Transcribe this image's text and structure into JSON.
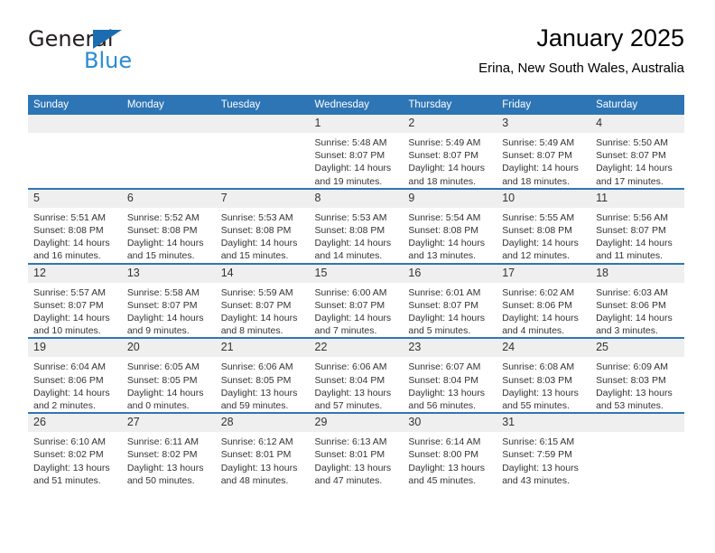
{
  "brand": {
    "name_part1": "General",
    "name_part2": "Blue",
    "triangle_color": "#1b6cb0",
    "blue_color": "#2a8bd4"
  },
  "header": {
    "title": "January 2025",
    "subtitle": "Erina, New South Wales, Australia"
  },
  "theme": {
    "header_bg": "#2e75b6",
    "daynum_bg": "#efefef",
    "separator": "#2e75b6"
  },
  "weekdays": [
    "Sunday",
    "Monday",
    "Tuesday",
    "Wednesday",
    "Thursday",
    "Friday",
    "Saturday"
  ],
  "labels": {
    "sunrise": "Sunrise:",
    "sunset": "Sunset:",
    "daylight": "Daylight:"
  },
  "weeks": [
    [
      {
        "day": "",
        "blank": true
      },
      {
        "day": "",
        "blank": true
      },
      {
        "day": "",
        "blank": true
      },
      {
        "day": "1",
        "sunrise": "Sunrise: 5:48 AM",
        "sunset": "Sunset: 8:07 PM",
        "daylight1": "Daylight: 14 hours",
        "daylight2": "and 19 minutes."
      },
      {
        "day": "2",
        "sunrise": "Sunrise: 5:49 AM",
        "sunset": "Sunset: 8:07 PM",
        "daylight1": "Daylight: 14 hours",
        "daylight2": "and 18 minutes."
      },
      {
        "day": "3",
        "sunrise": "Sunrise: 5:49 AM",
        "sunset": "Sunset: 8:07 PM",
        "daylight1": "Daylight: 14 hours",
        "daylight2": "and 18 minutes."
      },
      {
        "day": "4",
        "sunrise": "Sunrise: 5:50 AM",
        "sunset": "Sunset: 8:07 PM",
        "daylight1": "Daylight: 14 hours",
        "daylight2": "and 17 minutes."
      }
    ],
    [
      {
        "day": "5",
        "sunrise": "Sunrise: 5:51 AM",
        "sunset": "Sunset: 8:08 PM",
        "daylight1": "Daylight: 14 hours",
        "daylight2": "and 16 minutes."
      },
      {
        "day": "6",
        "sunrise": "Sunrise: 5:52 AM",
        "sunset": "Sunset: 8:08 PM",
        "daylight1": "Daylight: 14 hours",
        "daylight2": "and 15 minutes."
      },
      {
        "day": "7",
        "sunrise": "Sunrise: 5:53 AM",
        "sunset": "Sunset: 8:08 PM",
        "daylight1": "Daylight: 14 hours",
        "daylight2": "and 15 minutes."
      },
      {
        "day": "8",
        "sunrise": "Sunrise: 5:53 AM",
        "sunset": "Sunset: 8:08 PM",
        "daylight1": "Daylight: 14 hours",
        "daylight2": "and 14 minutes."
      },
      {
        "day": "9",
        "sunrise": "Sunrise: 5:54 AM",
        "sunset": "Sunset: 8:08 PM",
        "daylight1": "Daylight: 14 hours",
        "daylight2": "and 13 minutes."
      },
      {
        "day": "10",
        "sunrise": "Sunrise: 5:55 AM",
        "sunset": "Sunset: 8:08 PM",
        "daylight1": "Daylight: 14 hours",
        "daylight2": "and 12 minutes."
      },
      {
        "day": "11",
        "sunrise": "Sunrise: 5:56 AM",
        "sunset": "Sunset: 8:07 PM",
        "daylight1": "Daylight: 14 hours",
        "daylight2": "and 11 minutes."
      }
    ],
    [
      {
        "day": "12",
        "sunrise": "Sunrise: 5:57 AM",
        "sunset": "Sunset: 8:07 PM",
        "daylight1": "Daylight: 14 hours",
        "daylight2": "and 10 minutes."
      },
      {
        "day": "13",
        "sunrise": "Sunrise: 5:58 AM",
        "sunset": "Sunset: 8:07 PM",
        "daylight1": "Daylight: 14 hours",
        "daylight2": "and 9 minutes."
      },
      {
        "day": "14",
        "sunrise": "Sunrise: 5:59 AM",
        "sunset": "Sunset: 8:07 PM",
        "daylight1": "Daylight: 14 hours",
        "daylight2": "and 8 minutes."
      },
      {
        "day": "15",
        "sunrise": "Sunrise: 6:00 AM",
        "sunset": "Sunset: 8:07 PM",
        "daylight1": "Daylight: 14 hours",
        "daylight2": "and 7 minutes."
      },
      {
        "day": "16",
        "sunrise": "Sunrise: 6:01 AM",
        "sunset": "Sunset: 8:07 PM",
        "daylight1": "Daylight: 14 hours",
        "daylight2": "and 5 minutes."
      },
      {
        "day": "17",
        "sunrise": "Sunrise: 6:02 AM",
        "sunset": "Sunset: 8:06 PM",
        "daylight1": "Daylight: 14 hours",
        "daylight2": "and 4 minutes."
      },
      {
        "day": "18",
        "sunrise": "Sunrise: 6:03 AM",
        "sunset": "Sunset: 8:06 PM",
        "daylight1": "Daylight: 14 hours",
        "daylight2": "and 3 minutes."
      }
    ],
    [
      {
        "day": "19",
        "sunrise": "Sunrise: 6:04 AM",
        "sunset": "Sunset: 8:06 PM",
        "daylight1": "Daylight: 14 hours",
        "daylight2": "and 2 minutes."
      },
      {
        "day": "20",
        "sunrise": "Sunrise: 6:05 AM",
        "sunset": "Sunset: 8:05 PM",
        "daylight1": "Daylight: 14 hours",
        "daylight2": "and 0 minutes."
      },
      {
        "day": "21",
        "sunrise": "Sunrise: 6:06 AM",
        "sunset": "Sunset: 8:05 PM",
        "daylight1": "Daylight: 13 hours",
        "daylight2": "and 59 minutes."
      },
      {
        "day": "22",
        "sunrise": "Sunrise: 6:06 AM",
        "sunset": "Sunset: 8:04 PM",
        "daylight1": "Daylight: 13 hours",
        "daylight2": "and 57 minutes."
      },
      {
        "day": "23",
        "sunrise": "Sunrise: 6:07 AM",
        "sunset": "Sunset: 8:04 PM",
        "daylight1": "Daylight: 13 hours",
        "daylight2": "and 56 minutes."
      },
      {
        "day": "24",
        "sunrise": "Sunrise: 6:08 AM",
        "sunset": "Sunset: 8:03 PM",
        "daylight1": "Daylight: 13 hours",
        "daylight2": "and 55 minutes."
      },
      {
        "day": "25",
        "sunrise": "Sunrise: 6:09 AM",
        "sunset": "Sunset: 8:03 PM",
        "daylight1": "Daylight: 13 hours",
        "daylight2": "and 53 minutes."
      }
    ],
    [
      {
        "day": "26",
        "sunrise": "Sunrise: 6:10 AM",
        "sunset": "Sunset: 8:02 PM",
        "daylight1": "Daylight: 13 hours",
        "daylight2": "and 51 minutes."
      },
      {
        "day": "27",
        "sunrise": "Sunrise: 6:11 AM",
        "sunset": "Sunset: 8:02 PM",
        "daylight1": "Daylight: 13 hours",
        "daylight2": "and 50 minutes."
      },
      {
        "day": "28",
        "sunrise": "Sunrise: 6:12 AM",
        "sunset": "Sunset: 8:01 PM",
        "daylight1": "Daylight: 13 hours",
        "daylight2": "and 48 minutes."
      },
      {
        "day": "29",
        "sunrise": "Sunrise: 6:13 AM",
        "sunset": "Sunset: 8:01 PM",
        "daylight1": "Daylight: 13 hours",
        "daylight2": "and 47 minutes."
      },
      {
        "day": "30",
        "sunrise": "Sunrise: 6:14 AM",
        "sunset": "Sunset: 8:00 PM",
        "daylight1": "Daylight: 13 hours",
        "daylight2": "and 45 minutes."
      },
      {
        "day": "31",
        "sunrise": "Sunrise: 6:15 AM",
        "sunset": "Sunset: 7:59 PM",
        "daylight1": "Daylight: 13 hours",
        "daylight2": "and 43 minutes."
      },
      {
        "day": "",
        "blank": true
      }
    ]
  ]
}
